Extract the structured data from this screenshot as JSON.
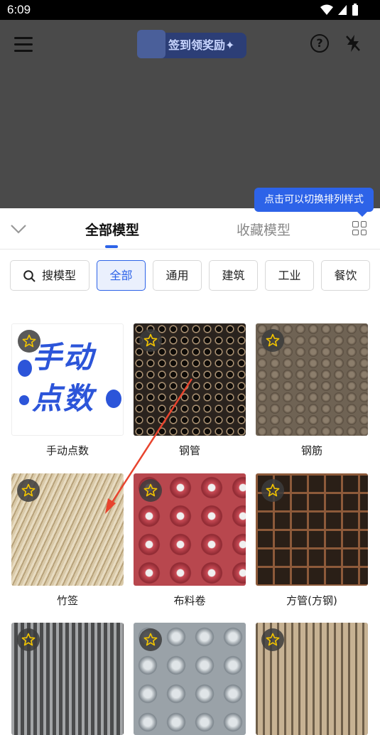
{
  "status_bar": {
    "time": "6:09"
  },
  "header": {
    "reward_label": "签到领奖励✦"
  },
  "tooltip": {
    "text": "点击可以切换排列样式"
  },
  "tabs": [
    {
      "label": "全部模型",
      "active": true
    },
    {
      "label": "收藏模型",
      "active": false
    }
  ],
  "chips": {
    "search_label": "搜模型",
    "items": [
      {
        "label": "全部",
        "active": true
      },
      {
        "label": "通用",
        "active": false
      },
      {
        "label": "建筑",
        "active": false
      },
      {
        "label": "工业",
        "active": false
      },
      {
        "label": "餐饮",
        "active": false
      }
    ]
  },
  "manual_thumb_text": "手动点数",
  "models": [
    {
      "name": "手动点数",
      "icon": "manual-count-image"
    },
    {
      "name": "钢管",
      "icon": "steel-pipe-image"
    },
    {
      "name": "钢筋",
      "icon": "rebar-image"
    },
    {
      "name": "竹签",
      "icon": "bamboo-skewer-image"
    },
    {
      "name": "布料卷",
      "icon": "fabric-roll-image"
    },
    {
      "name": "方管(方钢)",
      "icon": "square-tube-image"
    }
  ],
  "colors": {
    "accent": "#2d63e8",
    "overlay": "#4a4a4a",
    "annotation_arrow": "#e8442e"
  }
}
